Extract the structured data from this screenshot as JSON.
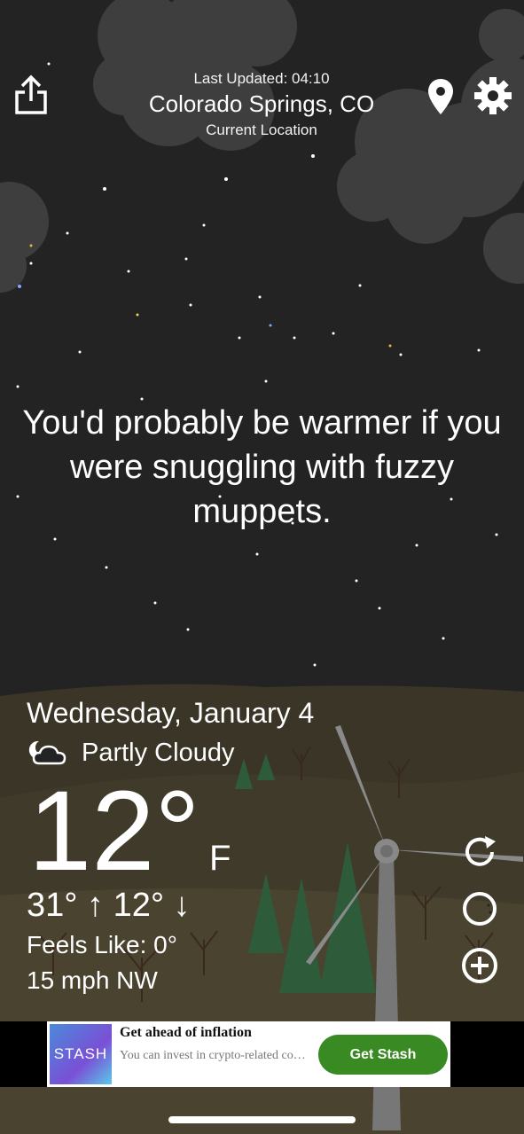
{
  "header": {
    "last_updated": "Last Updated: 04:10",
    "city": "Colorado Springs, CO",
    "location_label": "Current Location",
    "share_icon": "share-icon",
    "location_icon": "location-pin-icon",
    "settings_icon": "gear-icon"
  },
  "quip": "You'd probably be warmer if you were snuggling with fuzzy muppets.",
  "weather": {
    "date": "Wednesday, January 4",
    "condition": "Partly Cloudy",
    "condition_icon": "partly-cloudy-night-icon",
    "temperature": "12°",
    "unit": "F",
    "high": "31°",
    "low": "12°",
    "feels_like": "Feels Like: 0°",
    "wind": "15 mph NW"
  },
  "side_actions": {
    "refresh_icon": "refresh-icon",
    "moon_icon": "moon-phase-icon",
    "add_icon": "add-icon"
  },
  "ad": {
    "logo": "STASH",
    "title": "Get ahead of inflation",
    "subtitle": "You can invest in crypto-related companies",
    "cta": "Get Stash"
  },
  "colors": {
    "sky": "#222222",
    "hills": "#3a3526",
    "ad_button": "#3a8a24"
  }
}
